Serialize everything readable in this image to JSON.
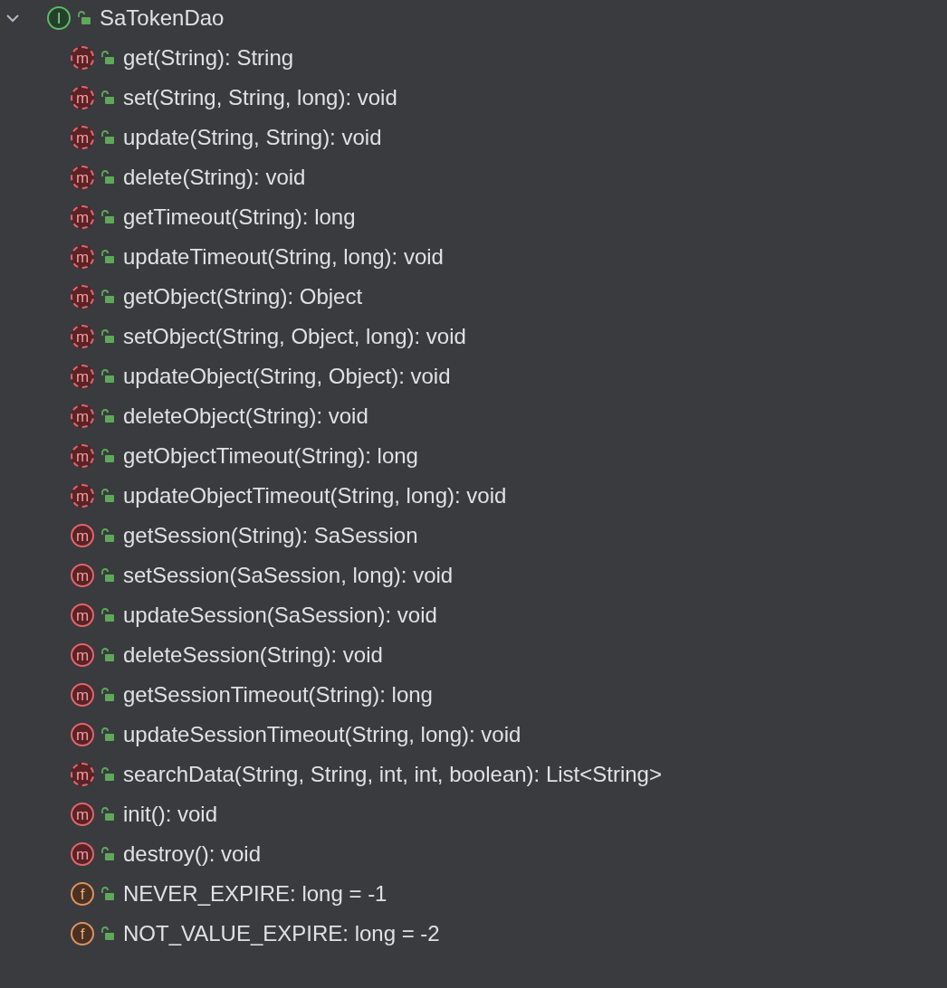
{
  "tree": {
    "label": "SaTokenDao",
    "badge": "I",
    "kind": "interface",
    "expanded": true,
    "children": [
      {
        "label": "get(String): String",
        "badge": "m",
        "kind": "method",
        "abstract": true
      },
      {
        "label": "set(String, String, long): void",
        "badge": "m",
        "kind": "method",
        "abstract": true
      },
      {
        "label": "update(String, String): void",
        "badge": "m",
        "kind": "method",
        "abstract": true
      },
      {
        "label": "delete(String): void",
        "badge": "m",
        "kind": "method",
        "abstract": true
      },
      {
        "label": "getTimeout(String): long",
        "badge": "m",
        "kind": "method",
        "abstract": true
      },
      {
        "label": "updateTimeout(String, long): void",
        "badge": "m",
        "kind": "method",
        "abstract": true
      },
      {
        "label": "getObject(String): Object",
        "badge": "m",
        "kind": "method",
        "abstract": true
      },
      {
        "label": "setObject(String, Object, long): void",
        "badge": "m",
        "kind": "method",
        "abstract": true
      },
      {
        "label": "updateObject(String, Object): void",
        "badge": "m",
        "kind": "method",
        "abstract": true
      },
      {
        "label": "deleteObject(String): void",
        "badge": "m",
        "kind": "method",
        "abstract": true
      },
      {
        "label": "getObjectTimeout(String): long",
        "badge": "m",
        "kind": "method",
        "abstract": true
      },
      {
        "label": "updateObjectTimeout(String, long): void",
        "badge": "m",
        "kind": "method",
        "abstract": true
      },
      {
        "label": "getSession(String): SaSession",
        "badge": "m",
        "kind": "method",
        "abstract": false
      },
      {
        "label": "setSession(SaSession, long): void",
        "badge": "m",
        "kind": "method",
        "abstract": false
      },
      {
        "label": "updateSession(SaSession): void",
        "badge": "m",
        "kind": "method",
        "abstract": false
      },
      {
        "label": "deleteSession(String): void",
        "badge": "m",
        "kind": "method",
        "abstract": false
      },
      {
        "label": "getSessionTimeout(String): long",
        "badge": "m",
        "kind": "method",
        "abstract": false
      },
      {
        "label": "updateSessionTimeout(String, long): void",
        "badge": "m",
        "kind": "method",
        "abstract": false
      },
      {
        "label": "searchData(String, String, int, int, boolean): List<String>",
        "badge": "m",
        "kind": "method",
        "abstract": true
      },
      {
        "label": "init(): void",
        "badge": "m",
        "kind": "method",
        "abstract": false
      },
      {
        "label": "destroy(): void",
        "badge": "m",
        "kind": "method",
        "abstract": false
      },
      {
        "label": "NEVER_EXPIRE: long = -1",
        "badge": "f",
        "kind": "field"
      },
      {
        "label": "NOT_VALUE_EXPIRE: long = -2",
        "badge": "f",
        "kind": "field"
      }
    ]
  }
}
